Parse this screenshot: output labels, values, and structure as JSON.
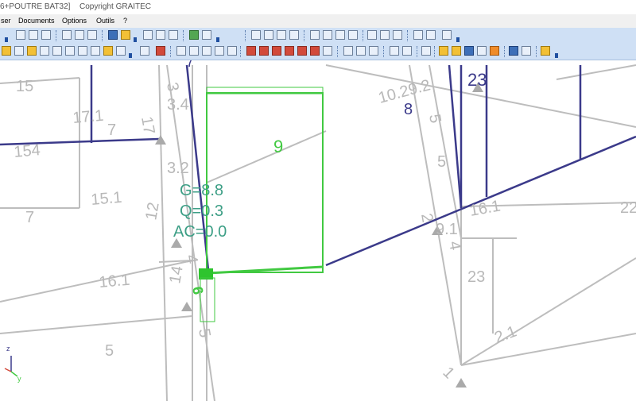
{
  "titlebar": {
    "doc_title": "6+POUTRE BAT32]",
    "copyright": "Copyright GRAITEC"
  },
  "menu": {
    "items": [
      "ser",
      "Documents",
      "Options",
      "Outils",
      "?"
    ]
  },
  "viewport": {
    "node_labels": [
      "15",
      "17.1",
      "7",
      "154",
      "7",
      "15.1",
      "16.1",
      "5",
      "3",
      "3.4",
      "17",
      "3.2",
      "12",
      "14",
      "4",
      "6",
      "5",
      "7",
      "23",
      "10.29.2",
      "8",
      "5",
      "5",
      "2",
      "9.1",
      "16.1",
      "4",
      "23",
      "22",
      "2.1",
      "1"
    ],
    "selected_element": {
      "number": "9",
      "loads": [
        "G=8.8",
        "Q=0.3",
        "AC=0.0"
      ]
    },
    "axis_labels": [
      "z",
      "y"
    ]
  },
  "colors": {
    "structure": "#bdbdbd",
    "beams": "#3b3a8a",
    "selection": "#41c941",
    "load_text": "#3d9f86",
    "toolbar_bg": "#cfe0f5"
  }
}
